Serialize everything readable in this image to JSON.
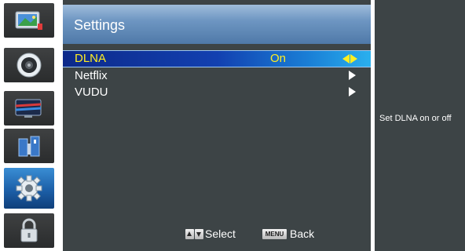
{
  "menu": {
    "title": "Settings",
    "items": [
      {
        "label": "DLNA",
        "value": "On"
      },
      {
        "label": "Netflix",
        "value": ""
      },
      {
        "label": "VUDU",
        "value": ""
      }
    ]
  },
  "sidebar": {
    "icons": [
      "picture-icon",
      "audio-icon",
      "tv-icon",
      "parental-icon",
      "settings-gear-icon",
      "lock-icon"
    ],
    "active_icon": "settings-gear-icon"
  },
  "footer": {
    "select_label": "Select",
    "menu_key_label": "MENU",
    "back_label": "Back"
  },
  "help": {
    "text": "Set DLNA on or off"
  },
  "colors": {
    "panel_bg": "#3d4446",
    "highlight_text": "#ffee22",
    "selected_row": "#1240b0",
    "header": "#6e96c2"
  }
}
